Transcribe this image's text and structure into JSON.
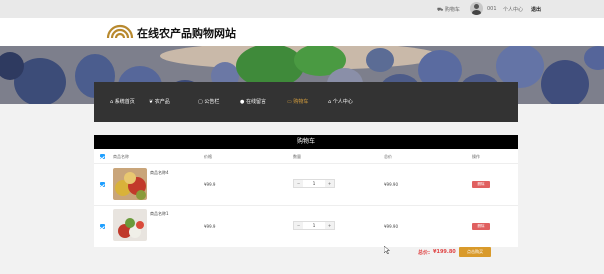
{
  "topbar": {
    "cart": "购物车",
    "username": "001",
    "profile": "个人中心",
    "logout": "退出"
  },
  "site": {
    "title": "在线农产品购物网站"
  },
  "nav": {
    "items": [
      {
        "label": "系统首页",
        "icon": "home-icon"
      },
      {
        "label": "农产品",
        "icon": "leaf-icon"
      },
      {
        "label": "公告栏",
        "icon": "lock-icon"
      },
      {
        "label": "在线留言",
        "icon": "circle-icon"
      },
      {
        "label": "购物车",
        "icon": "cart-icon",
        "active": true
      },
      {
        "label": "个人中心",
        "icon": "home-icon"
      }
    ]
  },
  "cart": {
    "title": "购物车",
    "headers": {
      "name": "商品名称",
      "price": "价格",
      "quantity": "数量",
      "subtotal": "总价",
      "action": "操作"
    },
    "items": [
      {
        "name": "商品名称4",
        "price": "¥99.9",
        "quantity": "1",
        "subtotal": "¥99.90",
        "delete": "删除"
      },
      {
        "name": "商品名称1",
        "price": "¥99.9",
        "quantity": "1",
        "subtotal": "¥99.90",
        "delete": "删除"
      }
    ],
    "total_label": "总价:",
    "total_value": "¥199.80",
    "checkout": "点击购买"
  },
  "colors": {
    "nav_bg": "#333333",
    "accent": "#d99a2b",
    "danger": "#e06060",
    "checkbox": "#1e9fff"
  }
}
